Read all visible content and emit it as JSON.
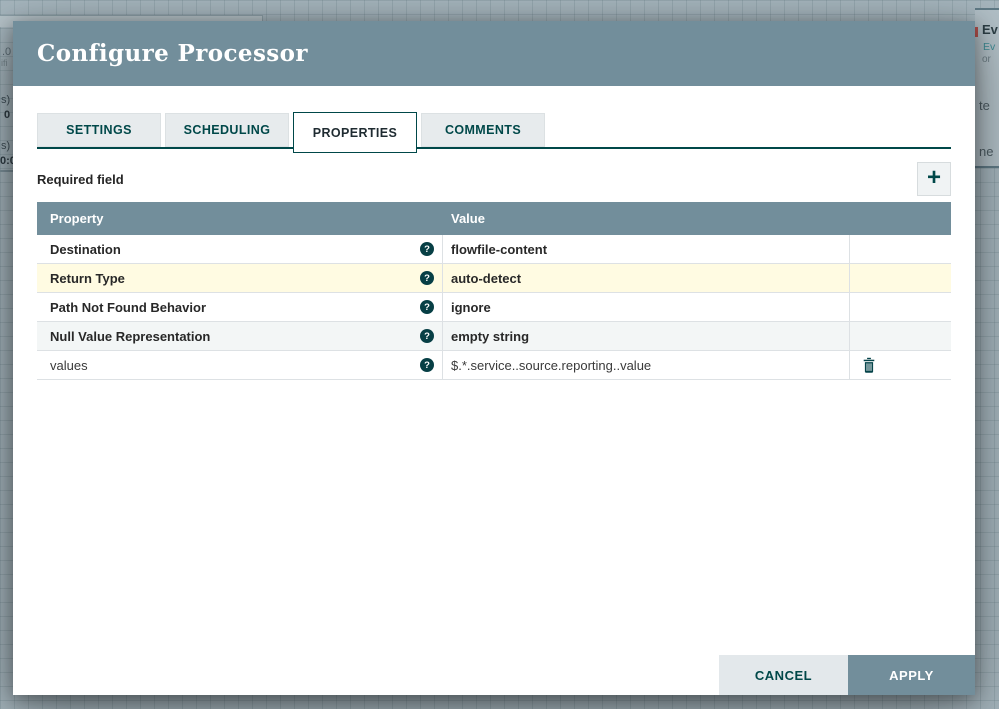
{
  "colors": {
    "accent": "#004849",
    "header_slate": "#728e9b",
    "highlight_row": "#fffbe2",
    "stripe_row": "#f3f6f6",
    "canvas": "#a6b6be"
  },
  "canvas": {
    "left_fragments": [
      ".0",
      "ifi",
      "s)",
      "0",
      "s)",
      "0:0"
    ],
    "right_fragments": [
      "Ev",
      "Ev",
      "or",
      "te",
      "ne"
    ]
  },
  "dialog": {
    "title": "Configure Processor",
    "tabs": [
      {
        "label": "SETTINGS",
        "active": false
      },
      {
        "label": "SCHEDULING",
        "active": false
      },
      {
        "label": "PROPERTIES",
        "active": true
      },
      {
        "label": "COMMENTS",
        "active": false
      }
    ],
    "required_field_label": "Required field",
    "add_button_label": "+",
    "table": {
      "headers": [
        "Property",
        "Value"
      ],
      "help_icon_glyph": "?",
      "rows": [
        {
          "property": "Destination",
          "value": "flowfile-content",
          "required": true,
          "highlighted": false,
          "deletable": false
        },
        {
          "property": "Return Type",
          "value": "auto-detect",
          "required": true,
          "highlighted": true,
          "deletable": false
        },
        {
          "property": "Path Not Found Behavior",
          "value": "ignore",
          "required": true,
          "highlighted": false,
          "deletable": false
        },
        {
          "property": "Null Value Representation",
          "value": "empty string",
          "required": true,
          "highlighted": false,
          "deletable": false
        },
        {
          "property": "values",
          "value": "$.*.service..source.reporting..value",
          "required": false,
          "highlighted": false,
          "deletable": true
        }
      ]
    },
    "footer": {
      "cancel_label": "CANCEL",
      "apply_label": "APPLY"
    }
  }
}
